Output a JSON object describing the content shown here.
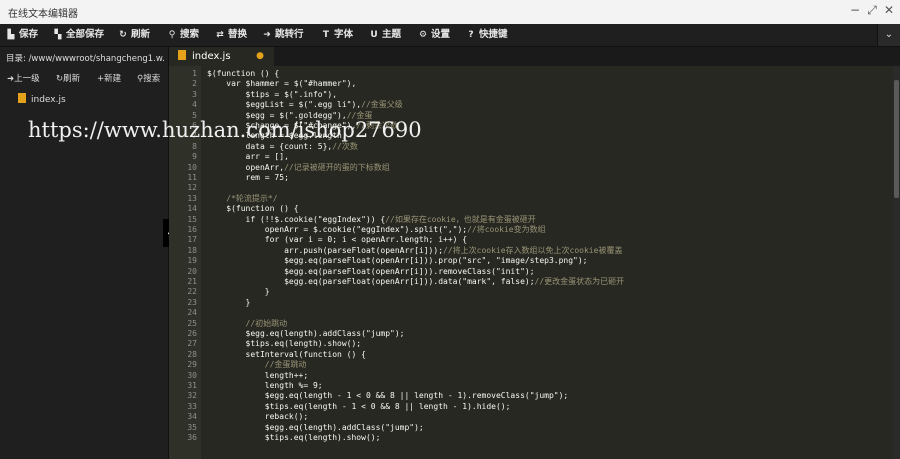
{
  "window": {
    "title": "在线文本编辑器"
  },
  "toolbar": {
    "items": [
      {
        "icon": "save-icon",
        "glyph": "▙",
        "label": "保存"
      },
      {
        "icon": "save-all-icon",
        "glyph": "▚",
        "label": "全部保存"
      },
      {
        "icon": "refresh-icon",
        "glyph": "↻",
        "label": "刷新"
      },
      {
        "icon": "search-icon",
        "glyph": "⚲",
        "label": "搜索"
      },
      {
        "icon": "replace-icon",
        "glyph": "⇄",
        "label": "替换"
      },
      {
        "icon": "goto-line-icon",
        "glyph": "➜",
        "label": "跳转行"
      },
      {
        "icon": "font-icon",
        "glyph": "T",
        "label": "字体"
      },
      {
        "icon": "theme-icon",
        "glyph": "U",
        "label": "主题"
      },
      {
        "icon": "settings-icon",
        "glyph": "⚙",
        "label": "设置"
      },
      {
        "icon": "shortcut-icon",
        "glyph": "?",
        "label": "快捷键"
      }
    ],
    "expand_glyph": "⌄"
  },
  "sidebar": {
    "path": "目录: /www/wwwroot/shangcheng1.w...",
    "actions": [
      {
        "icon": "back-icon",
        "glyph": "➜",
        "label": "上一级"
      },
      {
        "icon": "refresh-icon",
        "glyph": "↻",
        "label": "刷新"
      },
      {
        "icon": "new-icon",
        "glyph": "+",
        "label": "新建"
      },
      {
        "icon": "search-icon",
        "glyph": "⚲",
        "label": "搜索"
      }
    ],
    "files": [
      {
        "name": "index.js"
      }
    ]
  },
  "tab": {
    "label": "index.js",
    "close_glyph": "●"
  },
  "watermark": "https://www.huzhan.com/ishop27690",
  "editor": {
    "lines": [
      {
        "n": "1",
        "code": "$(function () {"
      },
      {
        "n": "2",
        "code": "    var $hammer = $(\"#hammer\"),"
      },
      {
        "n": "3",
        "code": "        $tips = $(\".info\"),"
      },
      {
        "n": "4",
        "code": "        $eggList = $(\".egg li\"),//金蛋父级"
      },
      {
        "n": "5",
        "code": "        $egg = $(\".goldegg\"),//金蛋"
      },
      {
        "n": "6",
        "code": "        $change = $(\"#change\"),//剩余次数"
      },
      {
        "n": "7",
        "code": "        length = $egg.length,"
      },
      {
        "n": "8",
        "code": "        data = {count: 5},//次数"
      },
      {
        "n": "9",
        "code": "        arr = [],"
      },
      {
        "n": "10",
        "code": "        openArr,//记录被砸开的蛋的下标数组"
      },
      {
        "n": "11",
        "code": "        rem = 75;"
      },
      {
        "n": "12",
        "code": ""
      },
      {
        "n": "13",
        "code": "    /*轮流提示*/"
      },
      {
        "n": "14",
        "code": "    $(function () {"
      },
      {
        "n": "15",
        "code": "        if (!!$.cookie(\"eggIndex\")) {//如果存在cookie，也就是有金蛋被砸开"
      },
      {
        "n": "16",
        "code": "            openArr = $.cookie(\"eggIndex\").split(\",\");//将cookie变为数组"
      },
      {
        "n": "17",
        "code": "            for (var i = 0; i < openArr.length; i++) {"
      },
      {
        "n": "18",
        "code": "                arr.push(parseFloat(openArr[i]));//将上次cookie存入数组以免上次cookie被覆盖"
      },
      {
        "n": "19",
        "code": "                $egg.eq(parseFloat(openArr[i])).prop(\"src\", \"image/step3.png\");"
      },
      {
        "n": "20",
        "code": "                $egg.eq(parseFloat(openArr[i])).removeClass(\"init\");"
      },
      {
        "n": "21",
        "code": "                $egg.eq(parseFloat(openArr[i])).data(\"mark\", false);//更改金蛋状态为已砸开"
      },
      {
        "n": "22",
        "code": "            }"
      },
      {
        "n": "23",
        "code": "        }"
      },
      {
        "n": "24",
        "code": ""
      },
      {
        "n": "25",
        "code": "        //初始跳动"
      },
      {
        "n": "26",
        "code": "        $egg.eq(length).addClass(\"jump\");"
      },
      {
        "n": "27",
        "code": "        $tips.eq(length).show();"
      },
      {
        "n": "28",
        "code": "        setInterval(function () {"
      },
      {
        "n": "29",
        "code": "            //金蛋跳动"
      },
      {
        "n": "30",
        "code": "            length++;"
      },
      {
        "n": "31",
        "code": "            length %= 9;"
      },
      {
        "n": "32",
        "code": "            $egg.eq(length - 1 < 0 && 8 || length - 1).removeClass(\"jump\");"
      },
      {
        "n": "33",
        "code": "            $tips.eq(length - 1 < 0 && 8 || length - 1).hide();"
      },
      {
        "n": "34",
        "code": "            reback();"
      },
      {
        "n": "35",
        "code": "            $egg.eq(length).addClass(\"jump\");"
      },
      {
        "n": "36",
        "code": "            $tips.eq(length).show();"
      }
    ]
  }
}
